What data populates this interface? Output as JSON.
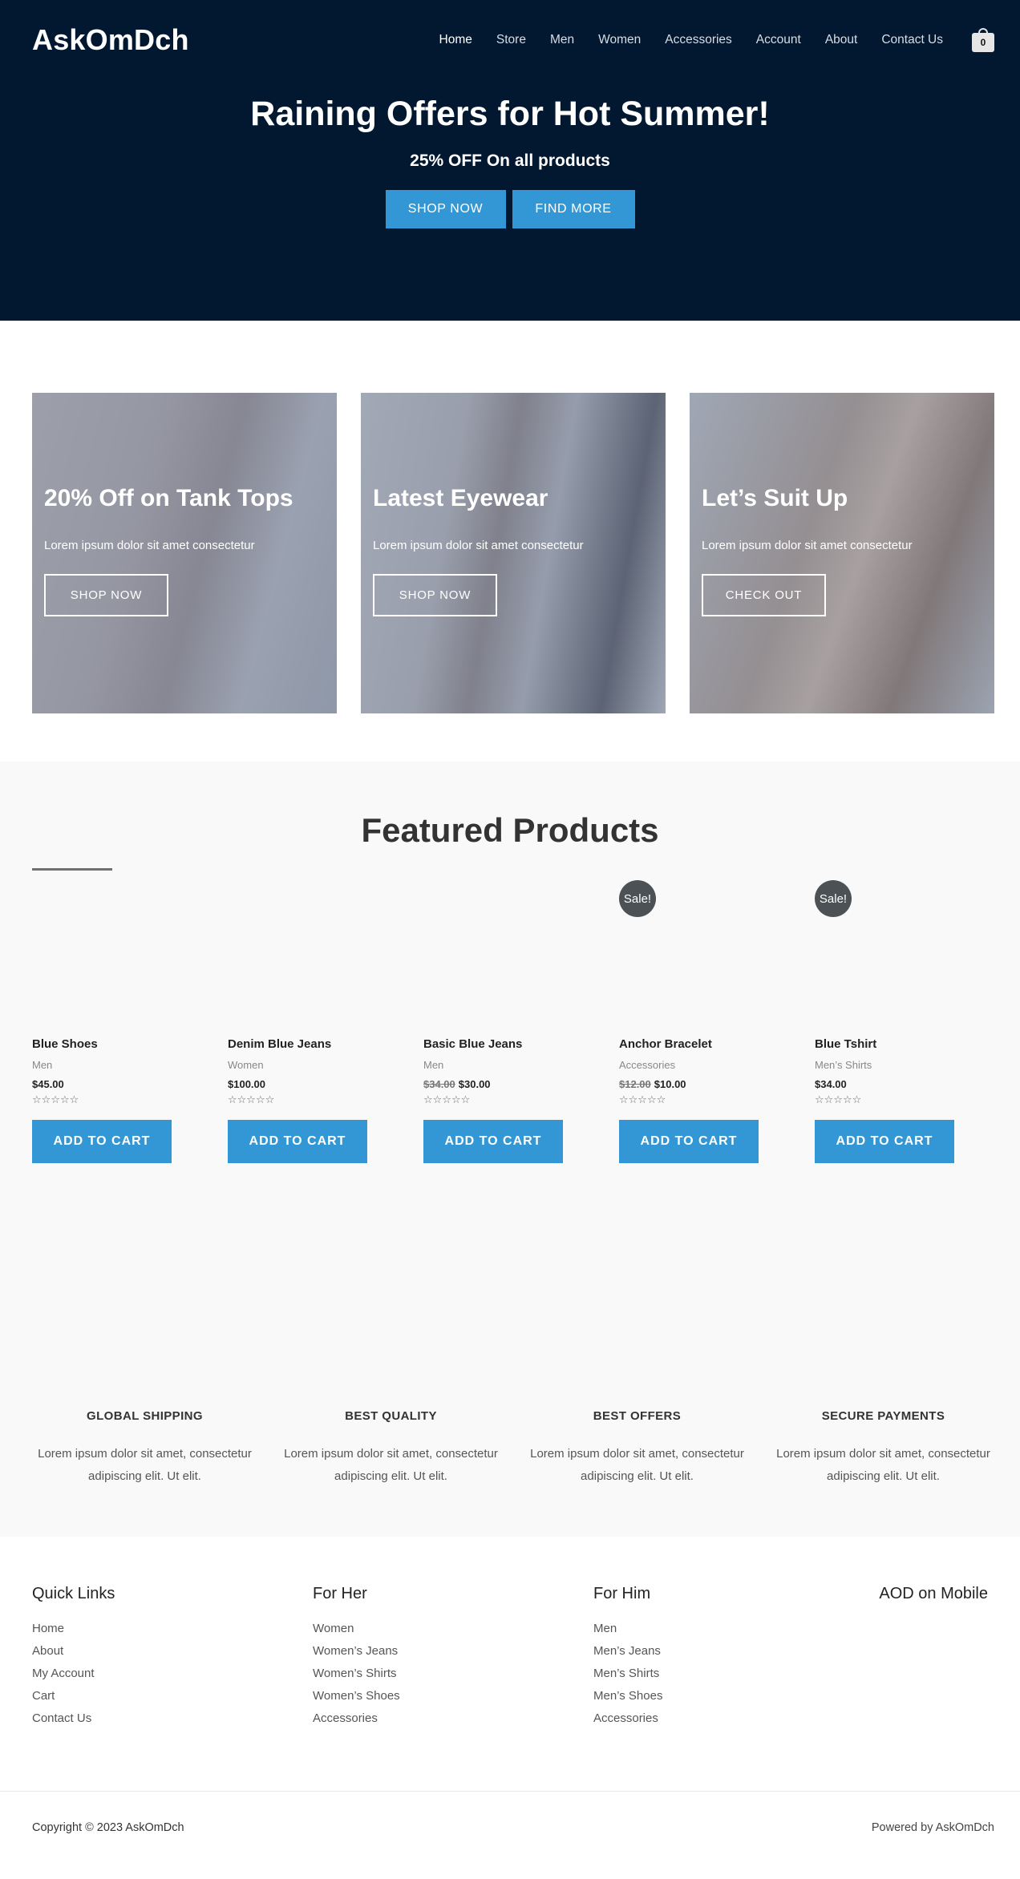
{
  "header": {
    "logo": "AskOmDch",
    "nav": [
      "Home",
      "Store",
      "Men",
      "Women",
      "Accessories",
      "Account",
      "About",
      "Contact Us"
    ],
    "cart_count": "0"
  },
  "hero": {
    "title": "Raining Offers for Hot Summer!",
    "subtitle": "25% OFF On all products",
    "primary_button": "SHOP NOW",
    "secondary_button": "FIND MORE"
  },
  "promos": [
    {
      "title": "20% Off on Tank Tops",
      "desc": "Lorem ipsum dolor sit amet consectetur",
      "button": "SHOP NOW"
    },
    {
      "title": "Latest Eyewear",
      "desc": "Lorem ipsum dolor sit amet consectetur",
      "button": "SHOP NOW"
    },
    {
      "title": "Let’s Suit Up",
      "desc": "Lorem ipsum dolor sit amet consectetur",
      "button": "CHECK OUT"
    }
  ],
  "featured": {
    "title": "Featured Products",
    "sale_badge": "Sale!",
    "stars": "☆☆☆☆☆",
    "add_to_cart": "ADD TO CART",
    "products": [
      {
        "name": "Blue Shoes",
        "category": "Men",
        "price": "$45.00",
        "old_price": ""
      },
      {
        "name": "Denim Blue Jeans",
        "category": "Women",
        "price": "$100.00",
        "old_price": ""
      },
      {
        "name": "Basic Blue Jeans",
        "category": "Men",
        "price": "$30.00",
        "old_price": "$34.00"
      },
      {
        "name": "Anchor Bracelet",
        "category": "Accessories",
        "price": "$10.00",
        "old_price": "$12.00"
      },
      {
        "name": "Blue Tshirt",
        "category": "Men’s Shirts",
        "price": "$34.00",
        "old_price": ""
      }
    ]
  },
  "features": [
    {
      "title": "GLOBAL SHIPPING",
      "line1": "Lorem ipsum dolor sit amet, consectetur",
      "line2": "adipiscing elit. Ut elit."
    },
    {
      "title": "BEST QUALITY",
      "line1": "Lorem ipsum dolor sit amet, consectetur",
      "line2": "adipiscing elit. Ut elit."
    },
    {
      "title": "BEST OFFERS",
      "line1": "Lorem ipsum dolor sit amet, consectetur",
      "line2": "adipiscing elit. Ut elit."
    },
    {
      "title": "SECURE PAYMENTS",
      "line1": "Lorem ipsum dolor sit amet, consectetur",
      "line2": "adipiscing elit. Ut elit."
    }
  ],
  "footer": {
    "quick_links": {
      "title": "Quick Links",
      "items": [
        "Home",
        "About",
        "My Account",
        "Cart",
        "Contact Us"
      ]
    },
    "for_her": {
      "title": "For Her",
      "items": [
        "Women",
        "Women’s Jeans",
        "Women’s Shirts",
        "Women’s Shoes",
        "Accessories"
      ]
    },
    "for_him": {
      "title": "For Him",
      "items": [
        "Men",
        "Men’s Jeans",
        "Men’s Shirts",
        "Men’s Shoes",
        "Accessories"
      ]
    },
    "mobile": {
      "title": "AOD on Mobile"
    },
    "copyright": "Copyright © 2023 AskOmDch",
    "powered": "Powered by AskOmDch"
  },
  "colors": {
    "hero_bg": "#021830",
    "accent": "#3397d6",
    "featured_bg": "#f9f9f9",
    "sale_badge": "#4b5155"
  }
}
